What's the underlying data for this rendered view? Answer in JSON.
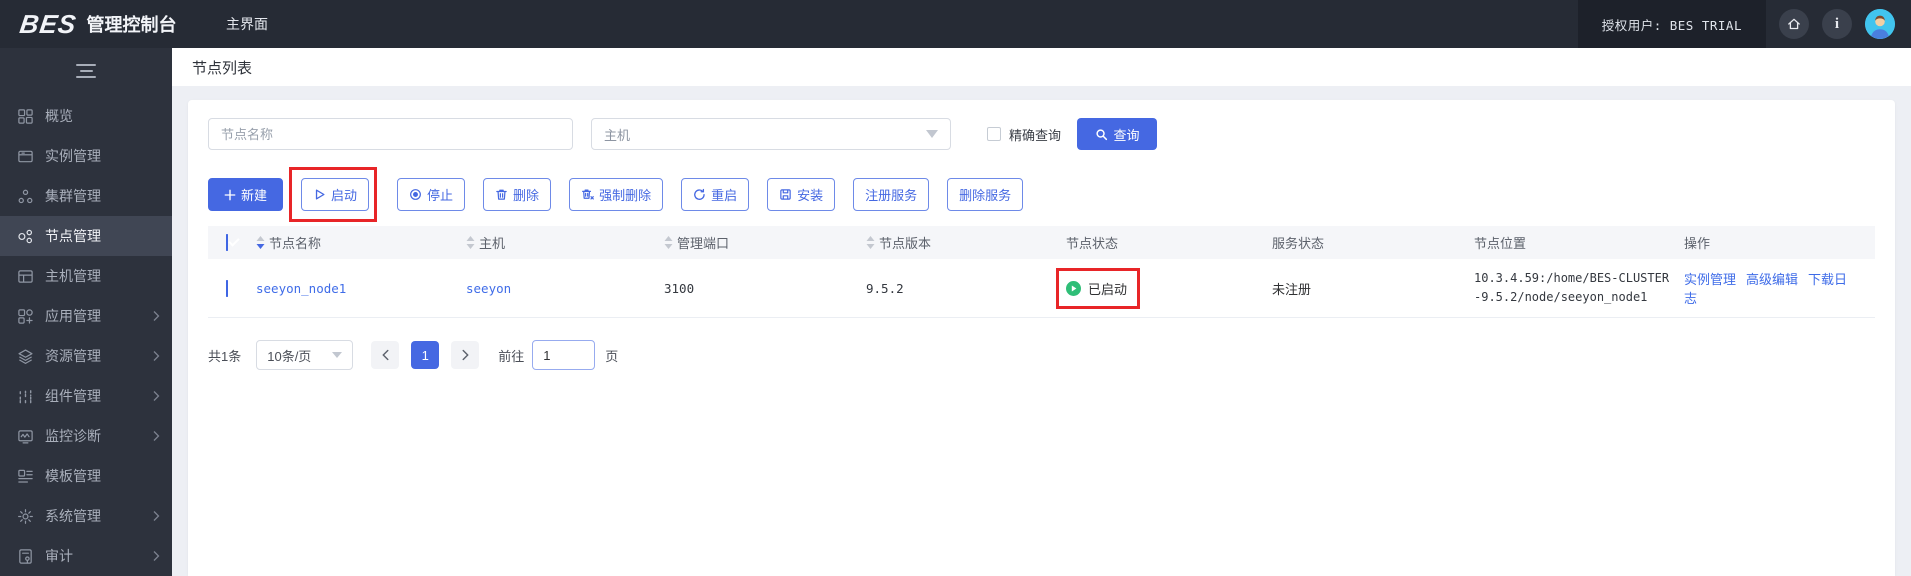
{
  "colors": {
    "accent_blue": "#4568e2",
    "link_blue": "#3f6ce8",
    "status_green": "#2fbe77",
    "annotation_red": "#e82528",
    "header_dark": "#262b35",
    "sidebar_dark": "#2d323d"
  },
  "header": {
    "logo": "BES",
    "app_title": "管理控制台",
    "nav_tab": "主界面",
    "licensed_user": "授权用户: BES TRIAL"
  },
  "sidebar": {
    "items": [
      {
        "label": "概览"
      },
      {
        "label": "实例管理"
      },
      {
        "label": "集群管理"
      },
      {
        "label": "节点管理",
        "active": true
      },
      {
        "label": "主机管理"
      },
      {
        "label": "应用管理",
        "expandable": true
      },
      {
        "label": "资源管理",
        "expandable": true
      },
      {
        "label": "组件管理",
        "expandable": true
      },
      {
        "label": "监控诊断",
        "expandable": true
      },
      {
        "label": "模板管理"
      },
      {
        "label": "系统管理",
        "expandable": true
      },
      {
        "label": "审计",
        "expandable": true
      }
    ]
  },
  "page": {
    "title": "节点列表"
  },
  "filters": {
    "node_name_placeholder": "节点名称",
    "host_select_value": "主机",
    "exact_query_label": "精确查询",
    "query_button_label": "查询"
  },
  "toolbar": {
    "buttons": [
      {
        "label": "新建"
      },
      {
        "label": "启动",
        "highlighted": true
      },
      {
        "label": "停止"
      },
      {
        "label": "删除"
      },
      {
        "label": "强制删除"
      },
      {
        "label": "重启"
      },
      {
        "label": "安装"
      },
      {
        "label": "注册服务"
      },
      {
        "label": "删除服务"
      }
    ]
  },
  "table": {
    "columns": [
      "节点名称",
      "主机",
      "管理端口",
      "节点版本",
      "节点状态",
      "服务状态",
      "节点位置",
      "操作"
    ],
    "rows": [
      {
        "node_name": "seeyon_node1",
        "host": "seeyon",
        "admin_port": "3100",
        "node_version": "9.5.2",
        "node_status": "已启动",
        "service_status": "未注册",
        "node_location": "10.3.4.59:/home/BES-CLUSTER-9.5.2/node/seeyon_node1",
        "actions": [
          "实例管理",
          "高级编辑",
          "下载日志"
        ]
      }
    ]
  },
  "pagination": {
    "total_label": "共1条",
    "page_size_value": "10条/页",
    "current_page": "1",
    "goto_label": "前往",
    "goto_value": "1",
    "page_unit_label": "页"
  }
}
